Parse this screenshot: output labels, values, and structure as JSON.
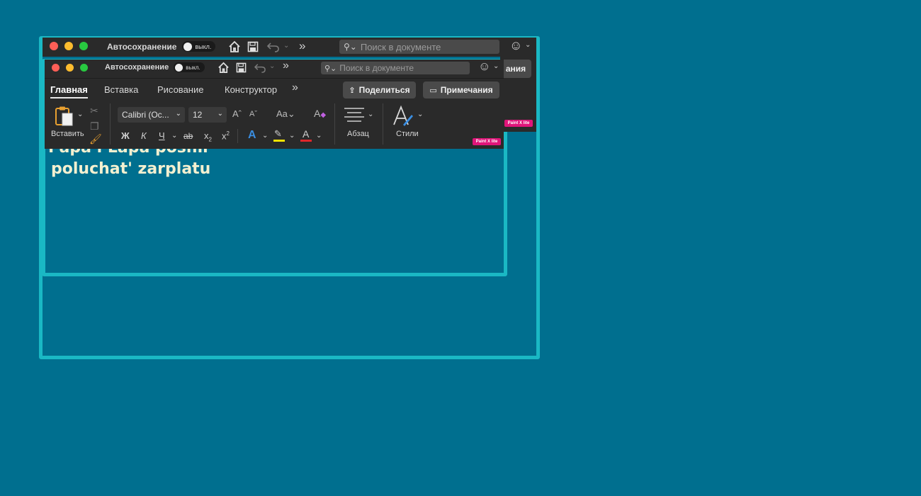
{
  "back_window": {
    "autosave_label": "Автосохранение",
    "toggle_label": "выкл.",
    "search_placeholder": "Поиск в документе",
    "partial_button_text": "ания",
    "badge": "Paint X lite"
  },
  "front_window": {
    "autosave_label": "Автосохранение",
    "toggle_label": "выкл.",
    "search_placeholder": "Поиск в документе",
    "tabs": [
      "Главная",
      "Вставка",
      "Рисование",
      "Конструктор"
    ],
    "share_button": "Поделиться",
    "comments_button": "Примечания",
    "paste_label": "Вставить",
    "font_name": "Calibri (Ос...",
    "font_size": "12",
    "format_labels": {
      "bold": "Ж",
      "italic": "К",
      "underline": "Ч",
      "strike": "ab"
    },
    "paragraph_label": "Абзац",
    "styles_label": "Стили",
    "badge": "Paint X lite"
  },
  "document": {
    "line1": "Papa i Lapa poshli",
    "line2": "poluchat' zarplatu"
  },
  "colors": {
    "background": "#006f8f",
    "outline": "#1ab8c4",
    "toolbar": "#2a2a2a",
    "text_highlight": "#f5e400",
    "font_color": "#e0262a",
    "badge": "#e0157a"
  }
}
